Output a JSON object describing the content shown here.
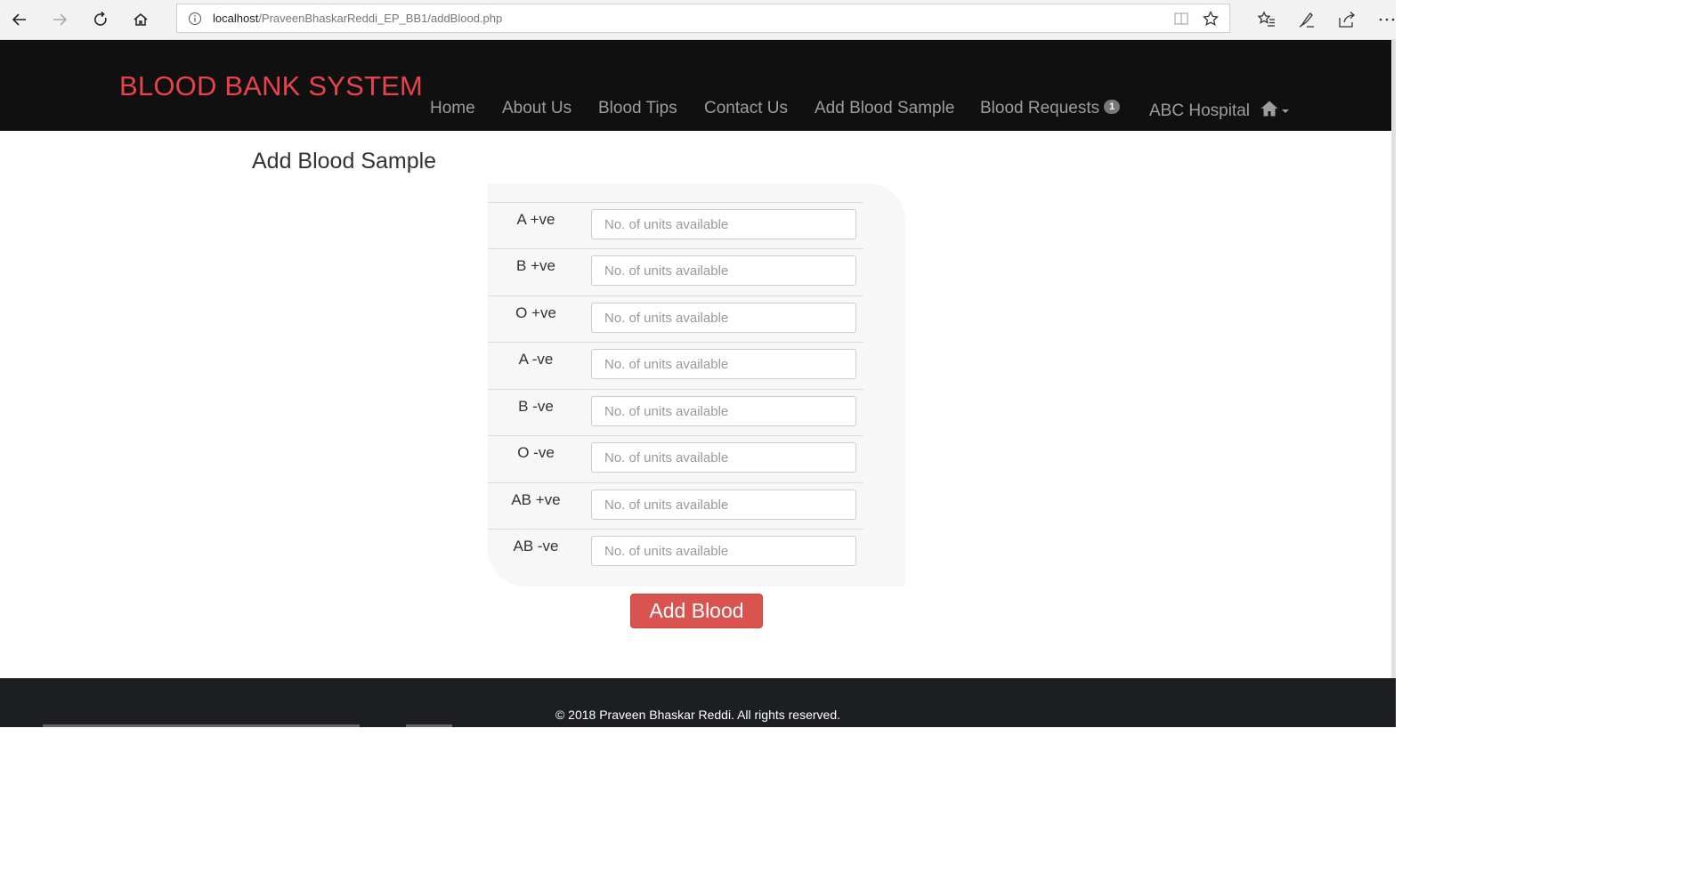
{
  "browser": {
    "url_host": "localhost",
    "url_path": "/PraveenBhaskarReddi_EP_BB1/addBlood.php",
    "icons": [
      "back-icon",
      "forward-icon",
      "refresh-icon",
      "home-icon",
      "info-icon",
      "reading-view-icon",
      "favorite-star-icon",
      "favorites-list-icon",
      "pen-icon",
      "share-icon",
      "more-icon"
    ]
  },
  "navbar": {
    "brand": "BLOOD BANK SYSTEM",
    "links": [
      "Home",
      "About Us",
      "Blood Tips",
      "Contact Us",
      "Add Blood Sample",
      "Blood Requests"
    ],
    "requests_badge": "1",
    "hospital_label": "ABC Hospital",
    "hospital_icon": "home-icon",
    "colors": {
      "background": "#101010",
      "brand": "#e8434b",
      "link": "#9d9d9d"
    }
  },
  "page": {
    "title": "Add Blood Sample"
  },
  "form": {
    "placeholder": "No. of units available",
    "rows": [
      {
        "label": "A +ve",
        "value": ""
      },
      {
        "label": "B +ve",
        "value": ""
      },
      {
        "label": "O +ve",
        "value": ""
      },
      {
        "label": "A -ve",
        "value": ""
      },
      {
        "label": "B -ve",
        "value": ""
      },
      {
        "label": "O -ve",
        "value": ""
      },
      {
        "label": "AB +ve",
        "value": ""
      },
      {
        "label": "AB -ve",
        "value": ""
      }
    ],
    "submit_label": "Add Blood",
    "submit_color": "#d9534f"
  },
  "footer": {
    "text": "© 2018 Praveen Bhaskar Reddi. All rights reserved."
  }
}
